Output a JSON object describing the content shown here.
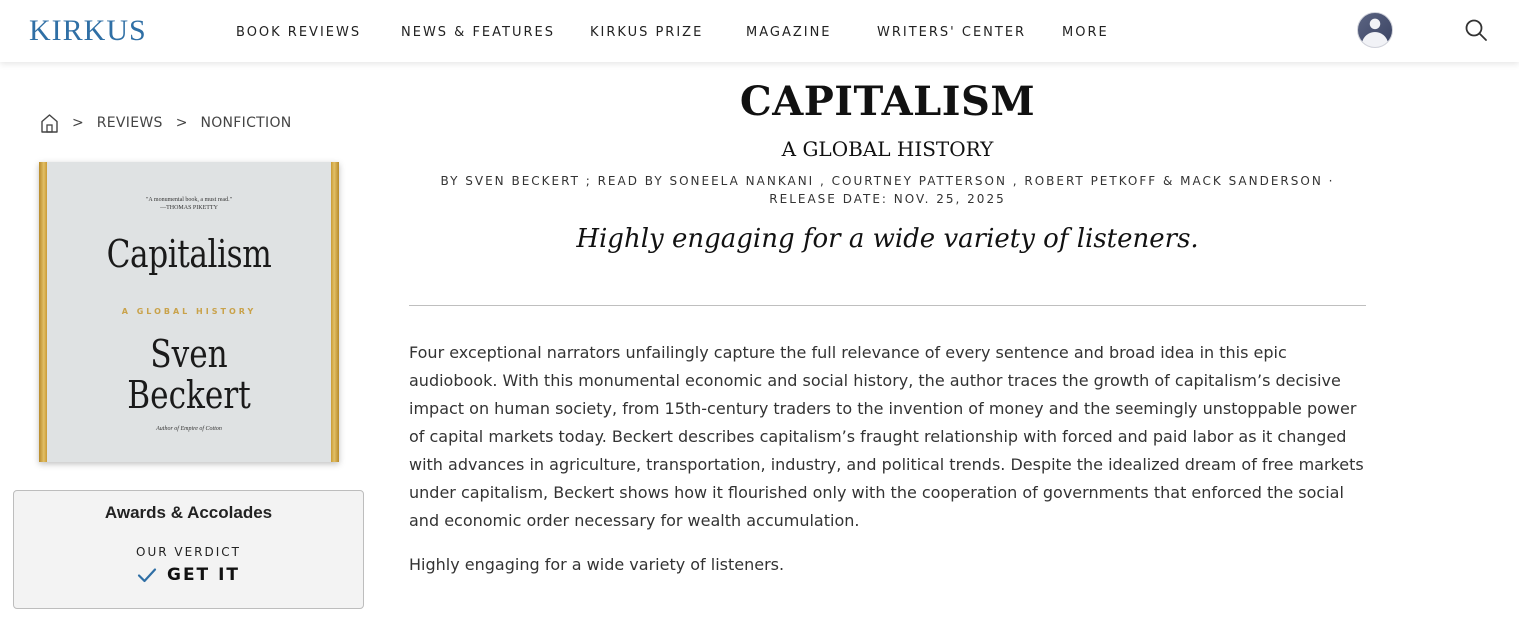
{
  "header": {
    "logo": "KIRKUS",
    "nav": [
      "BOOK REVIEWS",
      "NEWS & FEATURES",
      "KIRKUS PRIZE",
      "MAGAZINE",
      "WRITERS' CENTER",
      "MORE"
    ]
  },
  "breadcrumb": {
    "items": [
      "REVIEWS",
      "NONFICTION"
    ],
    "separator": ">"
  },
  "cover": {
    "quote": "\"A monumental book, a must read.\"",
    "quote_attribution": "—THOMAS PIKETTY",
    "title": "Capitalism",
    "subtitle": "A GLOBAL HISTORY",
    "author_line1": "Sven",
    "author_line2": "Beckert",
    "author_note": "Author of Empire of Cotton"
  },
  "awards": {
    "title": "Awards & Accolades",
    "verdict_label": "OUR VERDICT",
    "verdict_value": "GET IT"
  },
  "book": {
    "title": "CAPITALISM",
    "subtitle": "A GLOBAL HISTORY",
    "byline": "BY SVEN BECKERT ; READ BY SONEELA NANKANI , COURTNEY PATTERSON , ROBERT PETKOFF & MACK SANDERSON · RELEASE DATE: NOV. 25, 2025",
    "pull_quote": "Highly engaging for a wide variety of listeners."
  },
  "review": {
    "body": "Four exceptional narrators unfailingly capture the full relevance of every sentence and broad idea in this epic audiobook. With this monumental economic and social history, the author traces the growth of capitalism’s decisive impact on human society, from 15th-century traders to the invention of money and the seemingly unstoppable power of capital markets today. Beckert describes capitalism’s fraught relationship with forced and paid labor as it changed with advances in agriculture, transportation, industry, and political trends. Despite the idealized dream of free markets under capitalism, Beckert shows how it flourished only with the cooperation of governments that enforced the social and economic order necessary for wealth accumulation.",
    "bottom_line": "Highly engaging for a wide variety of listeners."
  },
  "colors": {
    "brand": "#2f6fa5",
    "cover_gold": "#c9a24a",
    "check": "#2f6fa5"
  },
  "icons": [
    "home-icon",
    "search-icon",
    "avatar",
    "check-icon"
  ]
}
